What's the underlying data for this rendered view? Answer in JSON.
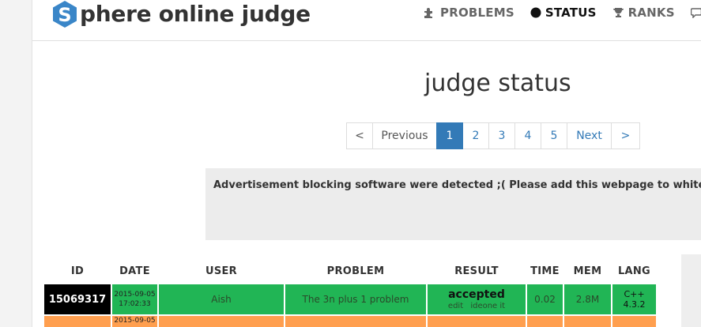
{
  "header": {
    "logo_letter": "S",
    "logo_text": "phere online judge",
    "nav": [
      {
        "label": "PROBLEMS",
        "icon": "puzzle-icon"
      },
      {
        "label": "STATUS",
        "icon": "circle-icon"
      },
      {
        "label": "RANKS",
        "icon": "trophy-icon"
      }
    ]
  },
  "page": {
    "title": "judge status"
  },
  "pagination": {
    "first": "<",
    "previous": "Previous",
    "pages": [
      "1",
      "2",
      "3",
      "4",
      "5"
    ],
    "active_page": "1",
    "next": "Next",
    "last": ">"
  },
  "ad_notice": "Advertisement blocking software were detected ;( Please add this webpage to whitelist.",
  "table": {
    "headers": [
      "ID",
      "DATE",
      "USER",
      "PROBLEM",
      "RESULT",
      "TIME",
      "MEM",
      "LANG"
    ],
    "rows": [
      {
        "id": "15069317",
        "date": "2015-09-05",
        "time_of_day": "17:02:33",
        "user": "Aish",
        "problem": "The 3n plus 1 problem",
        "result": "accepted",
        "result_links": [
          "edit",
          "ideone it"
        ],
        "time": "0.02",
        "mem": "2.8M",
        "lang_line1": "C++",
        "lang_line2": "4.3.2"
      },
      {
        "id": "",
        "date": "2015-09-05",
        "time_of_day": "",
        "user": "",
        "problem": "",
        "result": "",
        "time": "",
        "mem": "",
        "lang_line1": "",
        "lang_line2": ""
      }
    ]
  },
  "colors": {
    "accepted": "#21b555",
    "row_orange": "#ff9f4f",
    "pagination_active": "#337ab7",
    "logo_blue": "#3a86c8"
  }
}
